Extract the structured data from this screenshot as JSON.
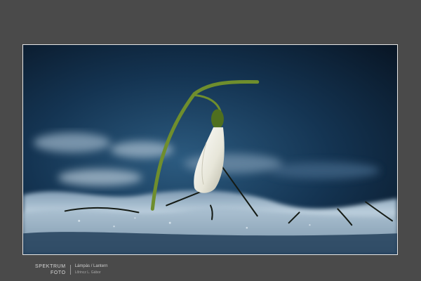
{
  "photo": {
    "subject": "snowdrop flower in snow",
    "colors": {
      "background": "#4a4a4a",
      "frame_border": "#e6e6e6",
      "sky_dark": "#050d18",
      "sky_blue": "#1e4566",
      "snow_light": "#c7d6e2",
      "petal": "#f2f1e6",
      "stem": "#7ea03a"
    }
  },
  "footer": {
    "brand_line1": "SPEKTRUM",
    "brand_line2": "FOTO",
    "caption_title": "Lámpás / Lantern",
    "caption_author": "Lőrincz L. Gábor"
  }
}
